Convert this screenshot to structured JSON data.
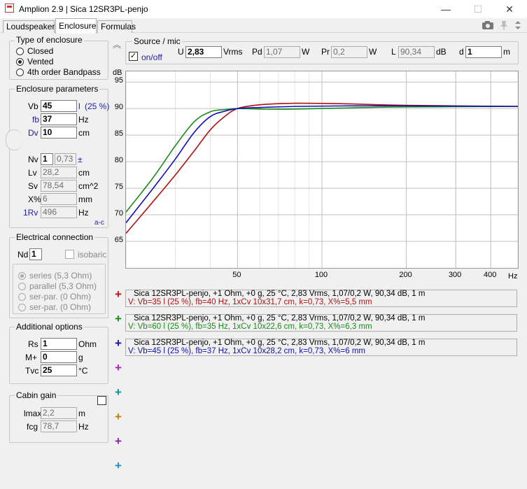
{
  "window": {
    "title": "Amplion 2.9 | Sica 12SR3PL-penjo",
    "minimize": "—",
    "maximize": "☐",
    "close": "✕"
  },
  "tabs": [
    "Loudspeaker",
    "Enclosure",
    "Formulas"
  ],
  "enclosure_type": {
    "title": "Type of enclosure",
    "options": [
      "Closed",
      "Vented",
      "4th order Bandpass"
    ],
    "selected": "Vented"
  },
  "enclosure_params": {
    "title": "Enclosure parameters",
    "vb": {
      "label": "Vb",
      "value": "45",
      "unit": "l",
      "extra": "(25 %)"
    },
    "fb": {
      "label": "fb",
      "value": "37",
      "unit": "Hz"
    },
    "dv": {
      "label": "Dv",
      "value": "10",
      "unit": "cm"
    },
    "nv": {
      "label": "Nv",
      "value": "1",
      "k": "0,73",
      "pm": "±"
    },
    "lv": {
      "label": "Lv",
      "value": "28,2",
      "unit": "cm"
    },
    "sv": {
      "label": "Sv",
      "value": "78,54",
      "unit": "cm^2"
    },
    "xp": {
      "label": "X%",
      "value": "6",
      "unit": "mm"
    },
    "rv": {
      "label": "1Rv",
      "value": "496",
      "unit": "Hz"
    },
    "ac": "a-c"
  },
  "electrical": {
    "title": "Electrical connection",
    "nd": {
      "label": "Nd",
      "value": "1"
    },
    "isobaric": "isobaric",
    "options": [
      "series (5,3 Ohm)",
      "parallel (5,3 Ohm)",
      "ser-par. (0 Ohm)",
      "ser-par. (0 Ohm)"
    ]
  },
  "additional": {
    "title": "Additional options",
    "rs": {
      "label": "Rs",
      "value": "1",
      "unit": "Ohm"
    },
    "m": {
      "label": "M+",
      "value": "0",
      "unit": "g"
    },
    "tvc": {
      "label": "Tvc",
      "value": "25",
      "unit": "°C"
    }
  },
  "cabin": {
    "title": "Cabin gain",
    "lmax": {
      "label": "lmax",
      "value": "2,2",
      "unit": "m"
    },
    "fcg": {
      "label": "fcg",
      "value": "78,7",
      "unit": "Hz"
    }
  },
  "source": {
    "title": "Source / mic",
    "onoff": "on/off",
    "u": {
      "label": "U",
      "value": "2,83",
      "unit": "Vrms"
    },
    "pd": {
      "label": "Pd",
      "value": "1,07",
      "unit": "W"
    },
    "pr": {
      "label": "Pr",
      "value": "0,2",
      "unit": "W"
    },
    "l": {
      "label": "L",
      "value": "90,34",
      "unit": "dB"
    },
    "d": {
      "label": "d",
      "value": "1",
      "unit": "m"
    }
  },
  "chart_data": {
    "type": "line",
    "ylabel": "dB",
    "xlabel": "Hz",
    "x_scale": "log",
    "xlim": [
      20,
      500
    ],
    "ylim": [
      60,
      97
    ],
    "yticks": [
      65,
      70,
      75,
      80,
      85,
      90,
      95
    ],
    "xticks": [
      50,
      100,
      200,
      300,
      400
    ],
    "grid": true,
    "series": [
      {
        "color": "#b01010",
        "points": [
          [
            20,
            66.5
          ],
          [
            25,
            72.5
          ],
          [
            30,
            77.5
          ],
          [
            35,
            82
          ],
          [
            40,
            86
          ],
          [
            45,
            88.5
          ],
          [
            50,
            90
          ],
          [
            60,
            90.7
          ],
          [
            80,
            91
          ],
          [
            120,
            90.9
          ],
          [
            200,
            90.6
          ],
          [
            500,
            90.4
          ]
        ]
      },
      {
        "color": "#1a8a1a",
        "points": [
          [
            20,
            70.5
          ],
          [
            25,
            77
          ],
          [
            30,
            83
          ],
          [
            35,
            87.5
          ],
          [
            40,
            89.4
          ],
          [
            45,
            89.8
          ],
          [
            50,
            90
          ],
          [
            60,
            89.9
          ],
          [
            80,
            89.9
          ],
          [
            120,
            90.1
          ],
          [
            200,
            90.3
          ],
          [
            500,
            90.4
          ]
        ]
      },
      {
        "color": "#1010b0",
        "points": [
          [
            20,
            68.5
          ],
          [
            25,
            75
          ],
          [
            30,
            80.5
          ],
          [
            35,
            85.5
          ],
          [
            40,
            88.5
          ],
          [
            45,
            89.5
          ],
          [
            50,
            90
          ],
          [
            60,
            90.2
          ],
          [
            80,
            90.4
          ],
          [
            120,
            90.5
          ],
          [
            200,
            90.5
          ],
          [
            500,
            90.4
          ]
        ]
      }
    ]
  },
  "rows": [
    {
      "l1": "Sica 12SR3PL-penjo, +1 Ohm, +0 g, 25 °C, 2,83 Vrms, 1,07/0,2 W, 90,34 dB, 1 m",
      "l2": "V: Vb=35 l (25 %), fb=40 Hz, 1xCv 10x31,7 cm, k=0,73, X%=5,5 mm",
      "color": "#b01010"
    },
    {
      "l1": "Sica 12SR3PL-penjo, +1 Ohm, +0 g, 25 °C, 2,83 Vrms, 1,07/0,2 W, 90,34 dB, 1 m",
      "l2": "V: Vb=60 l (25 %), fb=35 Hz, 1xCv 10x22,6 cm, k=0,73, X%=6,3 mm",
      "color": "#1a8a1a"
    },
    {
      "l1": "Sica 12SR3PL-penjo, +1 Ohm, +0 g, 25 °C, 2,83 Vrms, 1,07/0,2 W, 90,34 dB, 1 m",
      "l2": "V: Vb=45 l (25 %), fb=37 Hz, 1xCv 10x28,2 cm, k=0,73, X%=6 mm",
      "color": "#1010b0"
    }
  ],
  "plus_colors": [
    "#c01010",
    "#1a8a1a",
    "#1010b0",
    "#b020c0",
    "#109090",
    "#c08010",
    "#9020b0",
    "#2090c0"
  ],
  "plus_glyph": "+",
  "collapse_glyph": "︽"
}
